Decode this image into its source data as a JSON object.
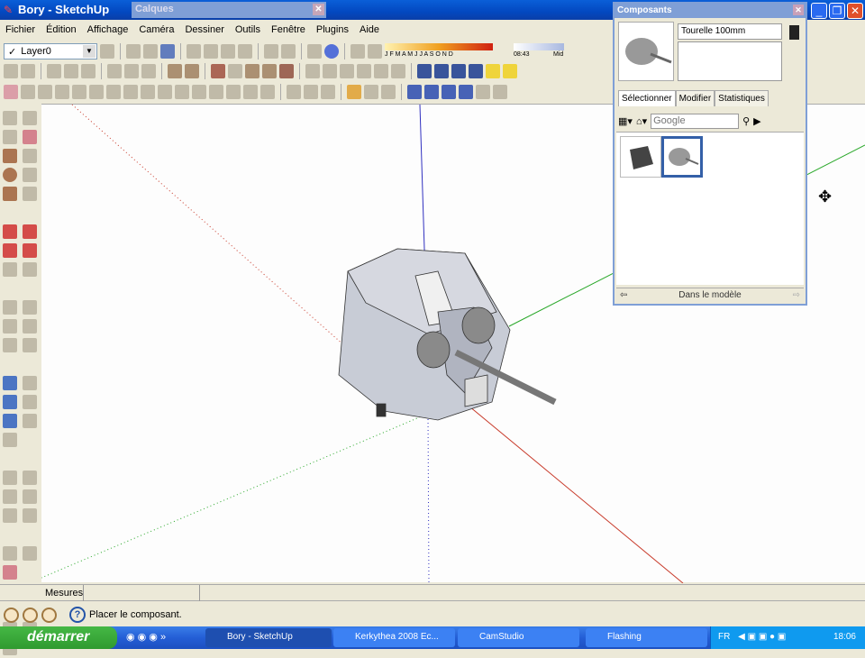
{
  "window": {
    "title": "Bory - SketchUp",
    "floating_title": "Calques"
  },
  "menu": [
    "Fichier",
    "Édition",
    "Affichage",
    "Caméra",
    "Dessiner",
    "Outils",
    "Fenêtre",
    "Plugins",
    "Aide"
  ],
  "layer_select": {
    "value": "Layer0"
  },
  "shadow_bar": {
    "months": "J F M A M J J A S O N D",
    "time": "08:43",
    "label": "Mid"
  },
  "components": {
    "title": "Composants",
    "name": "Tourelle 100mm",
    "tabs": [
      "Sélectionner",
      "Modifier",
      "Statistiques"
    ],
    "search_placeholder": "Google",
    "footer": "Dans le modèle"
  },
  "measures": {
    "label": "Mesures"
  },
  "status": {
    "text": "Placer le composant."
  },
  "taskbar": {
    "start": "démarrer",
    "tasks": [
      "Bory - SketchUp",
      "Kerkythea 2008 Ec...",
      "CamStudio",
      "Flashing"
    ],
    "lang": "FR",
    "clock": "18:06"
  },
  "colors": {
    "red_axis": "#c83a2a",
    "green_axis": "#2aa82a",
    "blue_axis": "#3030c0",
    "select": "#3460a8"
  }
}
